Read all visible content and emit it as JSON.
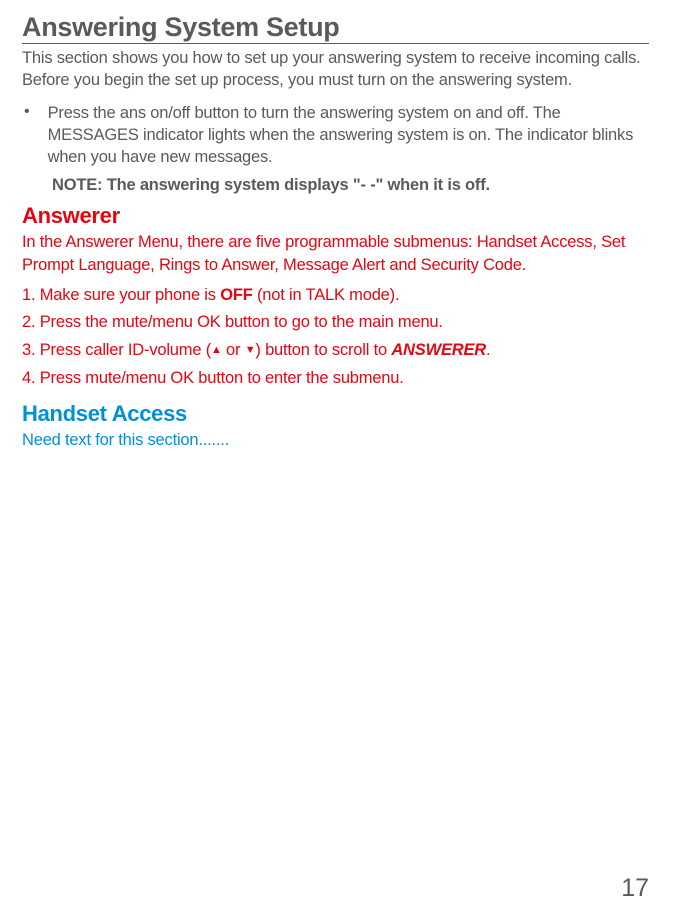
{
  "heading": "Answering System Setup",
  "intro": "This section shows you how to set up your answering system to receive incoming calls. Before you begin the set up process, you must turn on the answering system.",
  "bullet_marker": "•",
  "bullet_text": "Press the ans on/off button to turn the answering system on and off. The MESSAGES indicator lights when the answering system is on. The indicator blinks when you have new messages.",
  "note": "NOTE: The answering system displays \"- -\" when it is off.",
  "answerer": {
    "heading": "Answerer",
    "intro": "In the Answerer Menu, there are five programmable submenus: Handset Access, Set Prompt Language, Rings to Answer, Message Alert and Security Code.",
    "step1_pre": "1. Make sure your phone is ",
    "step1_bold": "OFF",
    "step1_post": " (not in TALK mode).",
    "step2": "2. Press the mute/menu OK button to go to the main menu.",
    "step3_pre": "3. Press caller ID-volume (",
    "step3_mid": " or ",
    "step3_mid2": ") button to scroll to ",
    "step3_bold": "ANSWERER",
    "step3_post": ".",
    "step4": "4. Press mute/menu OK button to enter the submenu."
  },
  "handset_access": {
    "heading": "Handset Access",
    "text": "Need text for this section......."
  },
  "page_number": "17",
  "icons": {
    "up_arrow": "▲",
    "down_arrow": "▼"
  }
}
